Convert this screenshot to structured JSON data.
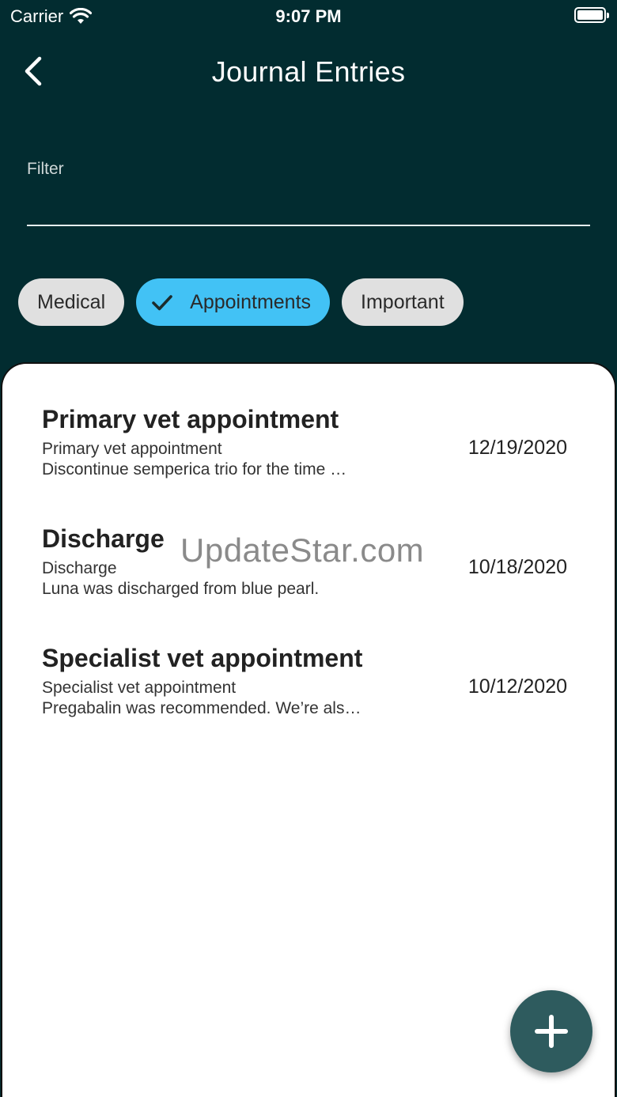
{
  "status_bar": {
    "carrier": "Carrier",
    "time": "9:07 PM"
  },
  "app_bar": {
    "title": "Journal Entries",
    "back_icon": "chevron-left-icon"
  },
  "filter": {
    "label": "Filter",
    "value": "",
    "placeholder": ""
  },
  "chips": [
    {
      "label": "Medical",
      "selected": false
    },
    {
      "label": "Appointments",
      "selected": true
    },
    {
      "label": "Important",
      "selected": false
    }
  ],
  "entries": [
    {
      "title": "Primary vet appointment",
      "subtitle": "Primary vet appointment",
      "snippet": "Discontinue semperica trio for the time …",
      "date": "12/19/2020"
    },
    {
      "title": "Discharge",
      "subtitle": "Discharge",
      "snippet": "Luna was discharged from blue pearl.",
      "date": "10/18/2020"
    },
    {
      "title": "Specialist vet appointment",
      "subtitle": "Specialist vet appointment",
      "snippet": "Pregabalin was recommended. We’re als…",
      "date": "10/12/2020"
    }
  ],
  "watermark": "UpdateStar.com",
  "fab": {
    "icon": "plus-icon"
  },
  "colors": {
    "header_bg": "#022c30",
    "chip_selected": "#42c2f5",
    "chip_default": "#e0e0e0",
    "fab_bg": "#2e5b5e"
  }
}
